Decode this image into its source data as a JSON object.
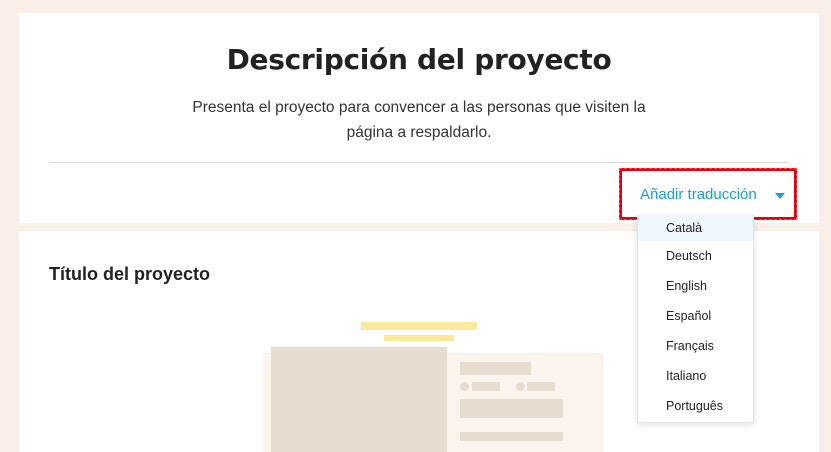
{
  "header": {
    "title": "Descripción del proyecto",
    "subtitle": "Presenta el proyecto para convencer a las personas que visiten la página a respaldarlo."
  },
  "translation": {
    "button_label": "Añadir traducción",
    "options": [
      "Català",
      "Deutsch",
      "English",
      "Español",
      "Français",
      "Italiano",
      "Português"
    ]
  },
  "section": {
    "title": "Título del proyecto"
  },
  "colors": {
    "page_background": "#f7efe8",
    "accent": "#1a9fcf",
    "highlight_border": "#e3000f",
    "illustration_yellow": "#fbe89a",
    "illustration_beige": "#e6ddd1"
  },
  "icons": {
    "dropdown_caret": "caret-down-icon"
  }
}
